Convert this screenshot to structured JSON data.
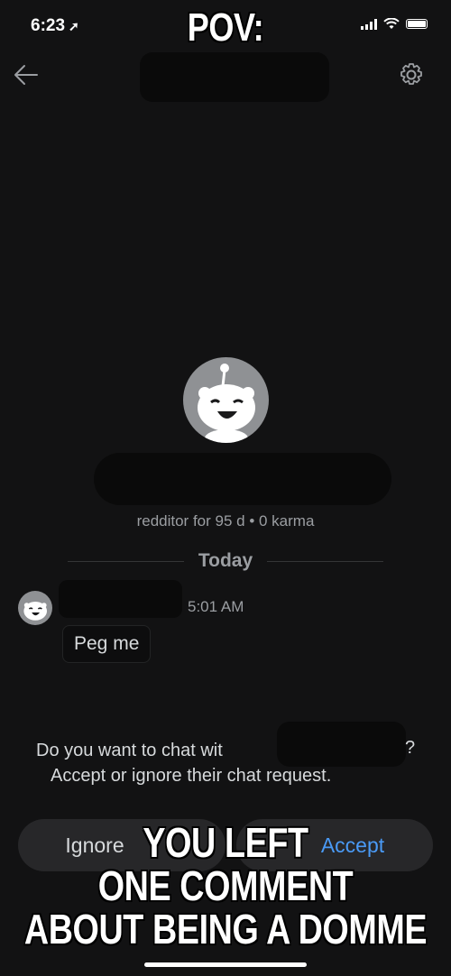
{
  "status_bar": {
    "time": "6:23",
    "location_arrow": "➚"
  },
  "header": {
    "back_icon": "back-arrow-icon",
    "settings_icon": "gear-icon"
  },
  "profile": {
    "meta": "redditor for 95 d • 0 karma"
  },
  "chat": {
    "day_label": "Today",
    "message_time": "5:01 AM",
    "message_text": "Peg me"
  },
  "request": {
    "line1": "Do you want to chat wit",
    "line2": "Accept or ignore their chat request.",
    "qmark": "?",
    "ignore_label": "Ignore",
    "accept_label": "Accept",
    "accent_color": "#4a9af5"
  },
  "meme": {
    "top": "POV:",
    "bottom_line1": "YOU LEFT",
    "bottom_line2": "ONE COMMENT",
    "bottom_line3": "ABOUT BEING A DOMME"
  }
}
